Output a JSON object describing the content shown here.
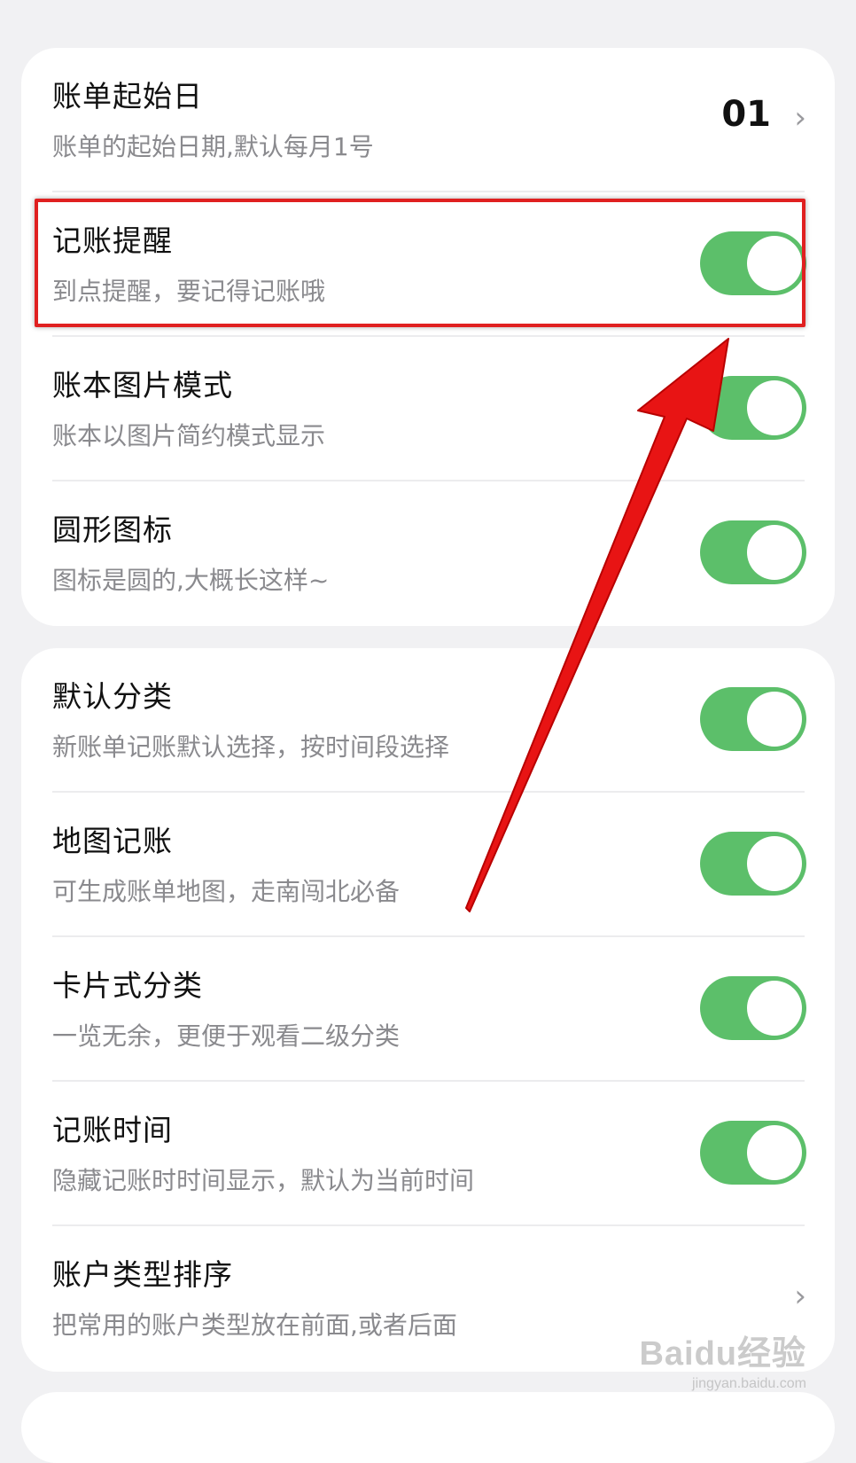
{
  "card1": {
    "bill_start": {
      "title": "账单起始日",
      "subtitle": "账单的起始日期,默认每月1号",
      "value": "01",
      "chevron": "chevron-right-icon"
    },
    "reminder": {
      "title": "记账提醒",
      "subtitle": "到点提醒，要记得记账哦",
      "on": true
    },
    "image_mode": {
      "title": "账本图片模式",
      "subtitle": "账本以图片简约模式显示",
      "on": true
    },
    "round_icon": {
      "title": "圆形图标",
      "subtitle": "图标是圆的,大概长这样~",
      "on": true
    }
  },
  "card2": {
    "default_category": {
      "title": "默认分类",
      "subtitle": "新账单记账默认选择，按时间段选择",
      "on": true
    },
    "map_bookkeeping": {
      "title": "地图记账",
      "subtitle": "可生成账单地图，走南闯北必备",
      "on": true
    },
    "card_category": {
      "title": "卡片式分类",
      "subtitle": "一览无余，更便于观看二级分类",
      "on": true
    },
    "bookkeeping_time": {
      "title": "记账时间",
      "subtitle": "隐藏记账时时间显示，默认为当前时间",
      "on": true
    },
    "account_sort": {
      "title": "账户类型排序",
      "subtitle": "把常用的账户类型放在前面,或者后面",
      "chevron": "chevron-right-icon"
    }
  },
  "colors": {
    "toggle_on": "#5cbf6a",
    "highlight": "#e02020",
    "arrow": "#e81414"
  },
  "watermark": {
    "main": "Baidu经验",
    "sub": "jingyan.baidu.com"
  }
}
